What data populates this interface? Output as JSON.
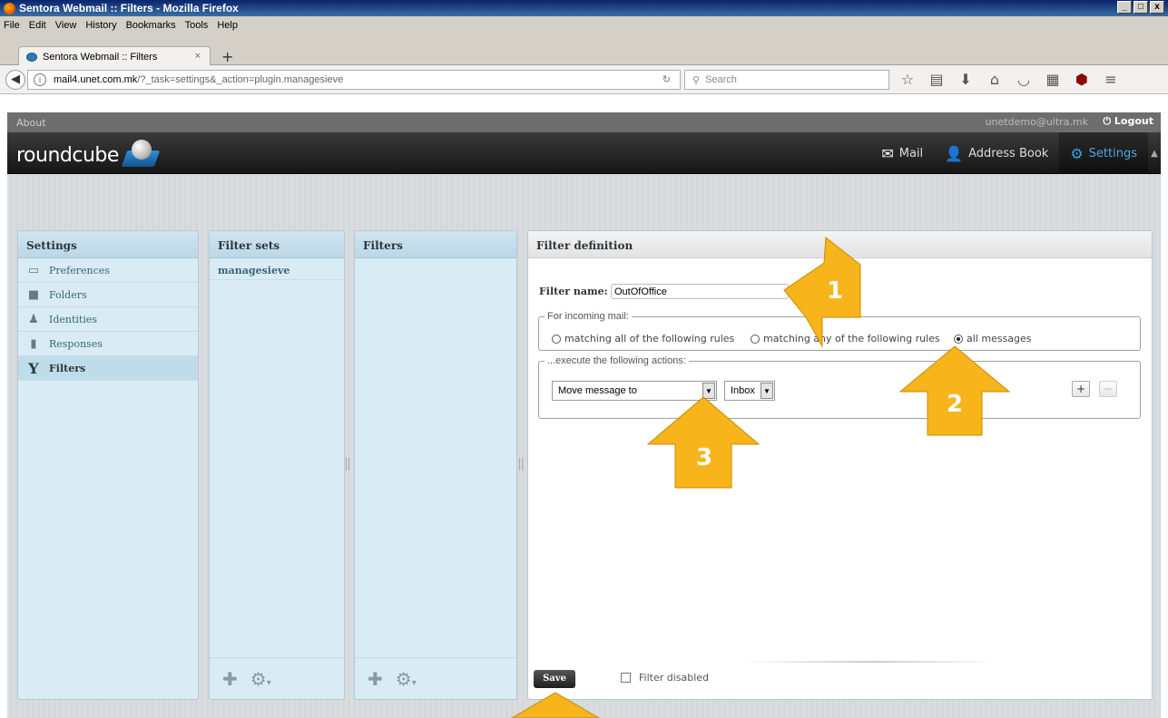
{
  "window": {
    "title": "Sentora Webmail :: Filters - Mozilla Firefox"
  },
  "menu": [
    "File",
    "Edit",
    "View",
    "History",
    "Bookmarks",
    "Tools",
    "Help"
  ],
  "tab": {
    "label": "Sentora Webmail :: Filters",
    "close": "×",
    "new_tab": "+"
  },
  "address": {
    "host": "mail4.unet.com.mk",
    "path": "/?_task=settings&_action=plugin.managesieve"
  },
  "search": {
    "placeholder": "Search"
  },
  "topline": {
    "about": "About",
    "user": "unetdemo@ultra.mk",
    "logout": "Logout"
  },
  "brand": {
    "name": "roundcube"
  },
  "tasks": [
    {
      "label": "Mail",
      "icon": "envelope-icon"
    },
    {
      "label": "Address Book",
      "icon": "person-icon"
    },
    {
      "label": "Settings",
      "icon": "gear-icon",
      "active": true
    }
  ],
  "settings_panel": {
    "title": "Settings",
    "items": [
      {
        "label": "Preferences",
        "icon": "monitor-icon"
      },
      {
        "label": "Folders",
        "icon": "folder-icon"
      },
      {
        "label": "Identities",
        "icon": "person-icon"
      },
      {
        "label": "Responses",
        "icon": "document-icon"
      },
      {
        "label": "Filters",
        "icon": "funnel-icon",
        "selected": true
      }
    ]
  },
  "filtersets_panel": {
    "title": "Filter sets",
    "items": [
      "managesieve"
    ]
  },
  "filters_panel": {
    "title": "Filters"
  },
  "definition": {
    "title": "Filter definition",
    "name_label": "Filter name:",
    "name_value": "OutOfOffice",
    "incoming_legend": "For incoming mail:",
    "rule_options": [
      "matching all of the following rules",
      "matching any of the following rules",
      "all messages"
    ],
    "rule_selected": "all messages",
    "actions_legend": "...execute the following actions:",
    "action_value": "Move message to",
    "folder_value": "Inbox",
    "add_label": "+",
    "remove_label": "−",
    "save_label": "Save",
    "disabled_label": "Filter disabled",
    "disabled_checked": false
  },
  "annotations": [
    "1",
    "2",
    "3"
  ],
  "colors": {
    "annotation": "#f7b41b",
    "accent": "#37a0e0",
    "panel_blue": "#d9ecf6"
  }
}
